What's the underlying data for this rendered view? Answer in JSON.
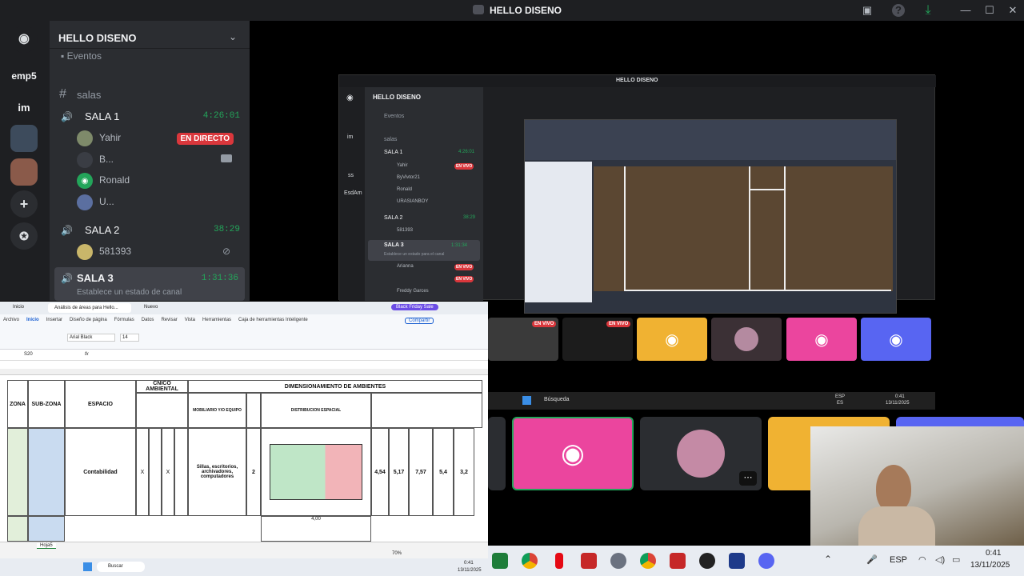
{
  "window_title": "HELLO DISENO",
  "server_rail": {
    "items": [
      "emp5",
      "im"
    ]
  },
  "channels": {
    "server_name": "HELLO DISENO",
    "events_label": "Eventos",
    "category": "salas",
    "rooms": [
      {
        "name": "SALA 1",
        "timer": "4:26:01",
        "users": [
          {
            "name": "Yahir",
            "live": "EN DIRECTO"
          },
          {
            "name": "B..."
          },
          {
            "name": "Ronald"
          },
          {
            "name": "U..."
          }
        ]
      },
      {
        "name": "SALA 2",
        "timer": "38:29",
        "users": [
          {
            "name": "581393"
          }
        ]
      },
      {
        "name": "SALA 3",
        "timer": "1:31:36",
        "status": "Establece un estado de canal"
      }
    ]
  },
  "inner_share": {
    "title": "HELLO DISENO",
    "server_name": "HELLO DISENO",
    "events_label": "Eventos",
    "category": "salas",
    "rail_labels": [
      "im",
      "ss",
      "EsdAm"
    ],
    "rooms": [
      {
        "name": "SALA 1",
        "timer": "4:26:01",
        "users": [
          "Yahir",
          "ByVivtor21",
          "Ronald",
          "URASIANBOY"
        ],
        "live": "EN VIVO"
      },
      {
        "name": "SALA 2",
        "timer": "38:29",
        "users": [
          "581393"
        ]
      },
      {
        "name": "SALA 3",
        "timer": "1:31:34",
        "users": [
          "Arianna",
          "Freddy Garces"
        ],
        "status": "Establece un estado para el canal",
        "live": "EN VIVO"
      }
    ]
  },
  "thumbnails": {
    "live_label": "EN VIVO"
  },
  "excel": {
    "tabs": [
      "Inicio",
      "Análisis de áreas para Hello..."
    ],
    "new_tab": "Nuevo",
    "black_friday": "Black Friday Sale",
    "menu": [
      "Archivo",
      "Inicio",
      "Insertar",
      "Diseño de página",
      "Fórmulas",
      "Datos",
      "Revisar",
      "Vista",
      "Herramientas",
      "Caja de herramientas Inteligente"
    ],
    "share_label": "Compartir",
    "font_name": "Arial Black",
    "font_size": "14",
    "cell_ref": "S20",
    "fx": "fx",
    "headers": {
      "tecnico": "CNICO AMBIENTAL",
      "dimensionamiento": "DIMENSIONAMIENTO DE AMBIENTES",
      "zona": "ZONA",
      "subzona": "SUB-ZONA",
      "espacio": "ESPACIO",
      "mobiliario": "MOBILIARIO Y/O EQUIPO",
      "distribucion": "DISTRIBUCION ESPACIAL"
    },
    "row": {
      "espacio": "Contabilidad",
      "x1": "X",
      "x2": "X",
      "mobiliario": "Sillas, escritorios, archivadores, computadores",
      "cantidad": "2",
      "values": [
        "4,54",
        "5,17",
        "7,57",
        "5,4",
        "3,2"
      ]
    },
    "sheet_tab": "Hoja5",
    "zoom": "70%",
    "plan_dim": "4,00"
  },
  "taskbar": {
    "lang": "ESP",
    "time": "0:41",
    "date": "13/11/2025"
  },
  "inner_taskbar": {
    "search": "Búsqueda",
    "lang": "ESP",
    "lang_sub": "ES",
    "time": "0:41",
    "date": "13/11/2025"
  },
  "excel_taskbar": {
    "search": "Buscar",
    "time": "0:41",
    "date": "13/11/2025"
  },
  "colors": {
    "discord_bg": "#1e1f22",
    "channel_bg": "#2b2d31",
    "green": "#23a55a",
    "live_red": "#da373c",
    "discord_pink": "#eb459e",
    "discord_blurple": "#5865f2",
    "discord_yellow": "#f0b232",
    "plan_brown": "#5b4732"
  }
}
